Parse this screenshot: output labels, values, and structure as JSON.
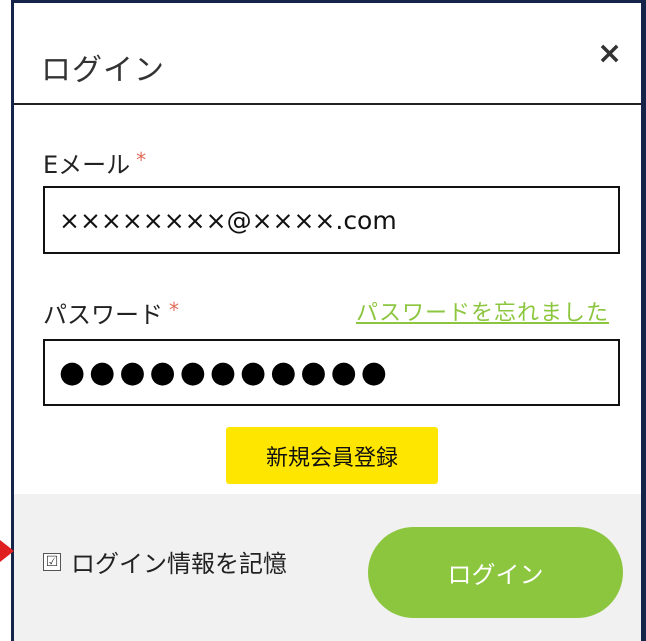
{
  "dialog": {
    "title": "ログイン",
    "close_icon": "×"
  },
  "email": {
    "label": "Eメール",
    "required_mark": "*",
    "value": "××××××××@××××.com"
  },
  "password": {
    "label": "パスワード",
    "required_mark": "*",
    "value": "●●●●●●●●●●●",
    "forgot_link": "パスワードを忘れました"
  },
  "register_button": "新規会員登録",
  "remember": {
    "checkbox_icon": "☑",
    "label": "ログイン情報を記憶"
  },
  "login_button": "ログイン",
  "colors": {
    "accent_green": "#8cc63f",
    "highlight_yellow": "#ffe600",
    "frame_navy": "#17244a",
    "required_red": "#e06c5a",
    "arrow_red": "#e02020"
  }
}
